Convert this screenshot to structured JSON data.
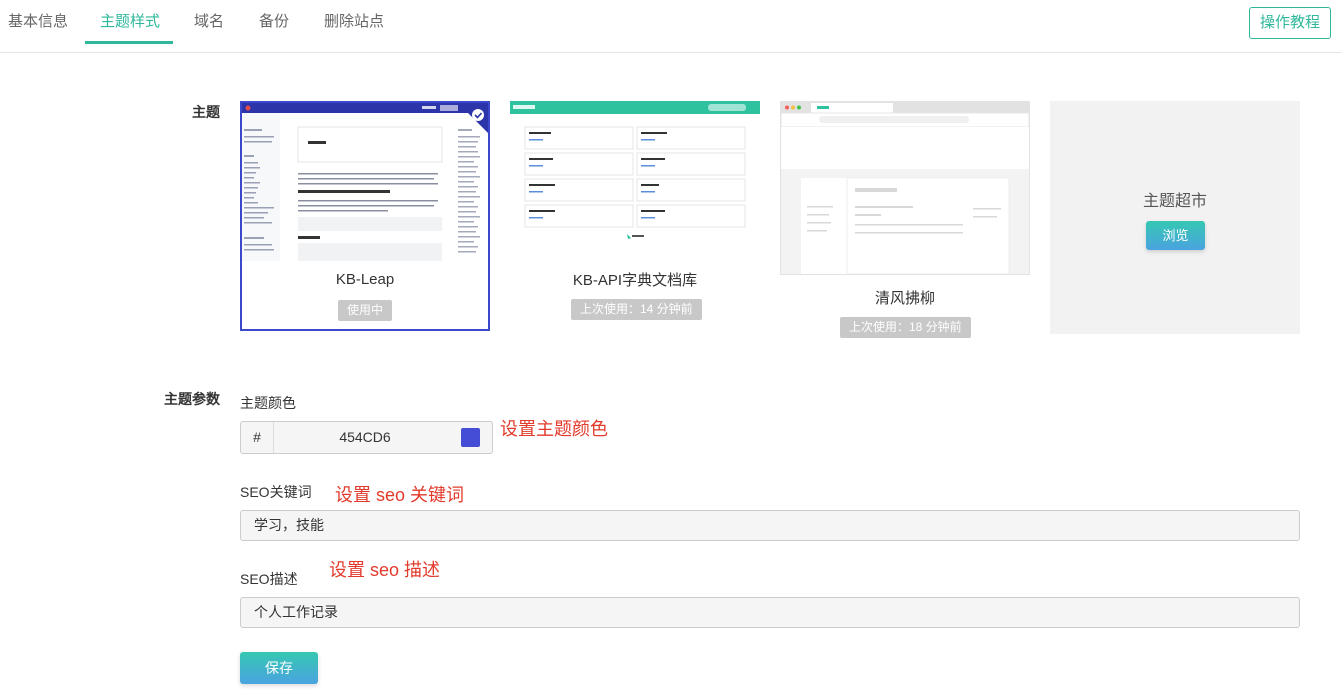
{
  "tabs": [
    {
      "label": "基本信息"
    },
    {
      "label": "主题样式"
    },
    {
      "label": "域名"
    },
    {
      "label": "备份"
    },
    {
      "label": "删除站点"
    }
  ],
  "guide_button": "操作教程",
  "theme_section_label": "主题",
  "themes": [
    {
      "name": "KB-Leap",
      "badge": "使用中",
      "selected": true
    },
    {
      "name": "KB-API字典文档库",
      "badge": "上次使用：14 分钟前",
      "selected": false
    },
    {
      "name": "清风拂柳",
      "badge": "上次使用：18 分钟前",
      "selected": false
    }
  ],
  "market": {
    "title": "主题超市",
    "button": "浏览"
  },
  "params_section_label": "主题参数",
  "color": {
    "label": "主题颜色",
    "prefix": "#",
    "value": "454CD6",
    "hint": "设置主题颜色",
    "swatch": "#454CD6"
  },
  "seo_keywords": {
    "label": "SEO关键词",
    "value": "学习，技能",
    "hint": "设置 seo 关键词"
  },
  "seo_description": {
    "label": "SEO描述",
    "value": "个人工作记录",
    "hint": "设置 seo 描述"
  },
  "save_button": "保存",
  "accent": "#2fb79b"
}
